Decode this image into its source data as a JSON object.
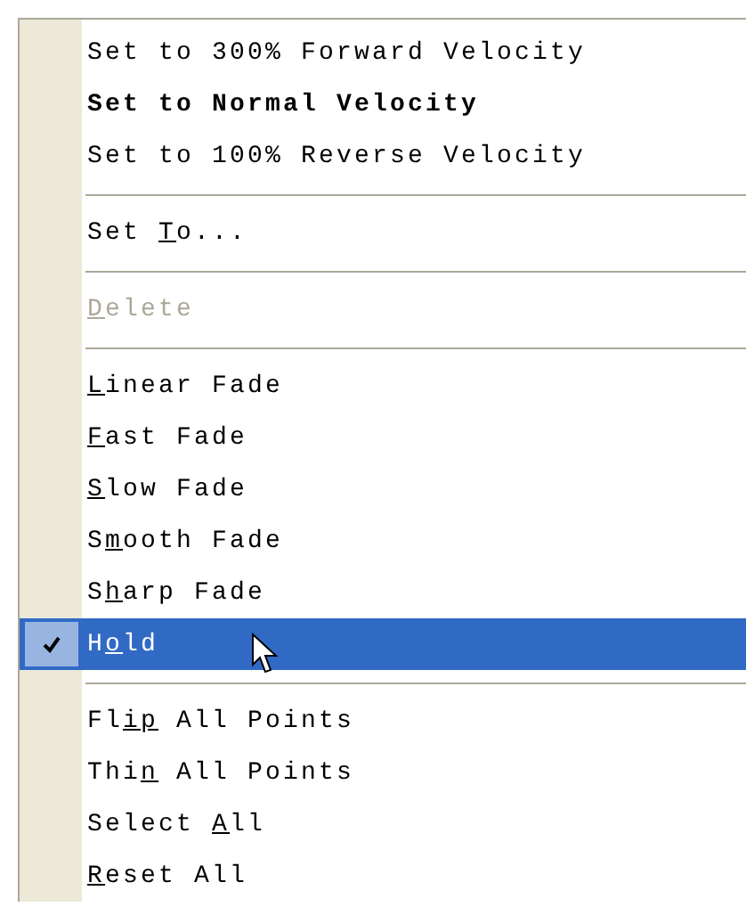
{
  "menu": {
    "items": [
      {
        "kind": "item",
        "label": {
          "before": "Set to 300% Forward Velocity"
        },
        "bold": false,
        "disabled": false,
        "checked": false,
        "selected": false
      },
      {
        "kind": "item",
        "label": {
          "before": "Set to Normal Velocity"
        },
        "bold": true,
        "disabled": false,
        "checked": false,
        "selected": false
      },
      {
        "kind": "item",
        "label": {
          "before": "Set to 100% Reverse Velocity"
        },
        "bold": false,
        "disabled": false,
        "checked": false,
        "selected": false
      },
      {
        "kind": "separator"
      },
      {
        "kind": "item",
        "label": {
          "before": "Set ",
          "key": "T",
          "after": "o..."
        },
        "bold": false,
        "disabled": false,
        "checked": false,
        "selected": false
      },
      {
        "kind": "separator"
      },
      {
        "kind": "item",
        "label": {
          "key": "D",
          "after": "elete"
        },
        "bold": false,
        "disabled": true,
        "checked": false,
        "selected": false
      },
      {
        "kind": "separator"
      },
      {
        "kind": "item",
        "label": {
          "key": "L",
          "after": "inear Fade"
        },
        "bold": false,
        "disabled": false,
        "checked": false,
        "selected": false
      },
      {
        "kind": "item",
        "label": {
          "key": "F",
          "after": "ast Fade"
        },
        "bold": false,
        "disabled": false,
        "checked": false,
        "selected": false
      },
      {
        "kind": "item",
        "label": {
          "key": "S",
          "after": "low Fade"
        },
        "bold": false,
        "disabled": false,
        "checked": false,
        "selected": false
      },
      {
        "kind": "item",
        "label": {
          "before": "S",
          "key": "m",
          "after": "ooth Fade"
        },
        "bold": false,
        "disabled": false,
        "checked": false,
        "selected": false
      },
      {
        "kind": "item",
        "label": {
          "before": "S",
          "key": "h",
          "after": "arp Fade"
        },
        "bold": false,
        "disabled": false,
        "checked": false,
        "selected": false
      },
      {
        "kind": "item",
        "label": {
          "before": "H",
          "key": "o",
          "after": "ld"
        },
        "bold": false,
        "disabled": false,
        "checked": true,
        "selected": true
      },
      {
        "kind": "separator"
      },
      {
        "kind": "item",
        "label": {
          "before": "Fl",
          "key": "ip",
          "after": " All Points"
        },
        "bold": false,
        "disabled": false,
        "checked": false,
        "selected": false
      },
      {
        "kind": "item",
        "label": {
          "before": "Thi",
          "key": "n",
          "after": " All Points"
        },
        "bold": false,
        "disabled": false,
        "checked": false,
        "selected": false
      },
      {
        "kind": "item",
        "label": {
          "before": "Select ",
          "key": "A",
          "after": "ll"
        },
        "bold": false,
        "disabled": false,
        "checked": false,
        "selected": false
      },
      {
        "kind": "item",
        "label": {
          "key": "R",
          "after": "eset All"
        },
        "bold": false,
        "disabled": false,
        "checked": false,
        "selected": false
      }
    ]
  }
}
